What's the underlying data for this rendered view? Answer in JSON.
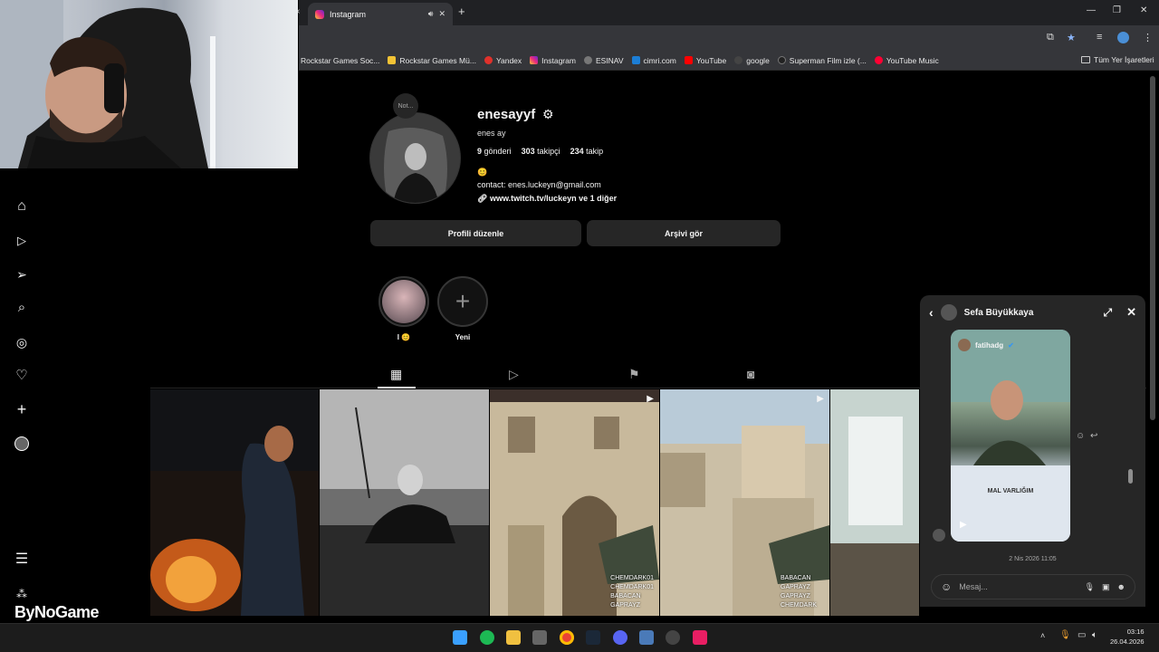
{
  "browser": {
    "tab_title": "Instagram",
    "bookmarks": [
      {
        "label": "Rockstar Games Soc...",
        "color": "#444444"
      },
      {
        "label": "Rockstar Games Mü...",
        "color": "#f2c335"
      },
      {
        "label": "Yandex",
        "color": "#e0312b"
      },
      {
        "label": "Instagram",
        "color": "#dd2a7b"
      },
      {
        "label": "ESINAV",
        "color": "#666666"
      },
      {
        "label": "cimri.com",
        "color": "#1c7ed6"
      },
      {
        "label": "YouTube",
        "color": "#ff0000"
      },
      {
        "label": "google",
        "color": "#555555"
      },
      {
        "label": "Superman Film izle (...",
        "color": "#333333"
      },
      {
        "label": "YouTube Music",
        "color": "#ff0033"
      }
    ],
    "all_bookmarks": "Tüm Yer İşaretleri"
  },
  "profile": {
    "note": "Not...",
    "username": "enesayyf",
    "full_name": "enes ay",
    "posts_count": "9",
    "posts_label": "gönderi",
    "followers_count": "303",
    "followers_label": "takipçi",
    "following_count": "234",
    "following_label": "takip",
    "bio_emoji": "😊",
    "contact": "contact: enes.luckeyn@gmail.com",
    "link": "www.twitch.tv/luckeyn ve 1 diğer",
    "edit_button": "Profili düzenle",
    "archive_button": "Arşivi gör"
  },
  "highlights": [
    {
      "label": "I 😊"
    },
    {
      "label": "Yeni"
    }
  ],
  "posts": [
    {
      "caption": []
    },
    {
      "caption": []
    },
    {
      "caption": [
        "CHEMDARK01",
        "CHEMDARK01",
        "BABACAN",
        "GAPRAYZ"
      ]
    },
    {
      "caption": [
        "BABACAN",
        "GAPRAYZ",
        "GAPRAYZ",
        "CHEMDARK"
      ]
    },
    {
      "caption": []
    }
  ],
  "chat": {
    "name": "Sefa Büyükkaya",
    "media_author": "fatihadg",
    "media_text": "MAL VARLIĞIM",
    "date": "2 Nis 2026 11:05",
    "input_placeholder": "Mesaj..."
  },
  "overlay": {
    "brand": "ByNoGame"
  },
  "taskbar": {
    "time": "03:16",
    "date": "26.04.2026"
  },
  "colors": {
    "background": "#000000",
    "panel": "#262626",
    "text": "#f5f5f5",
    "muted": "#a8a8a8"
  }
}
